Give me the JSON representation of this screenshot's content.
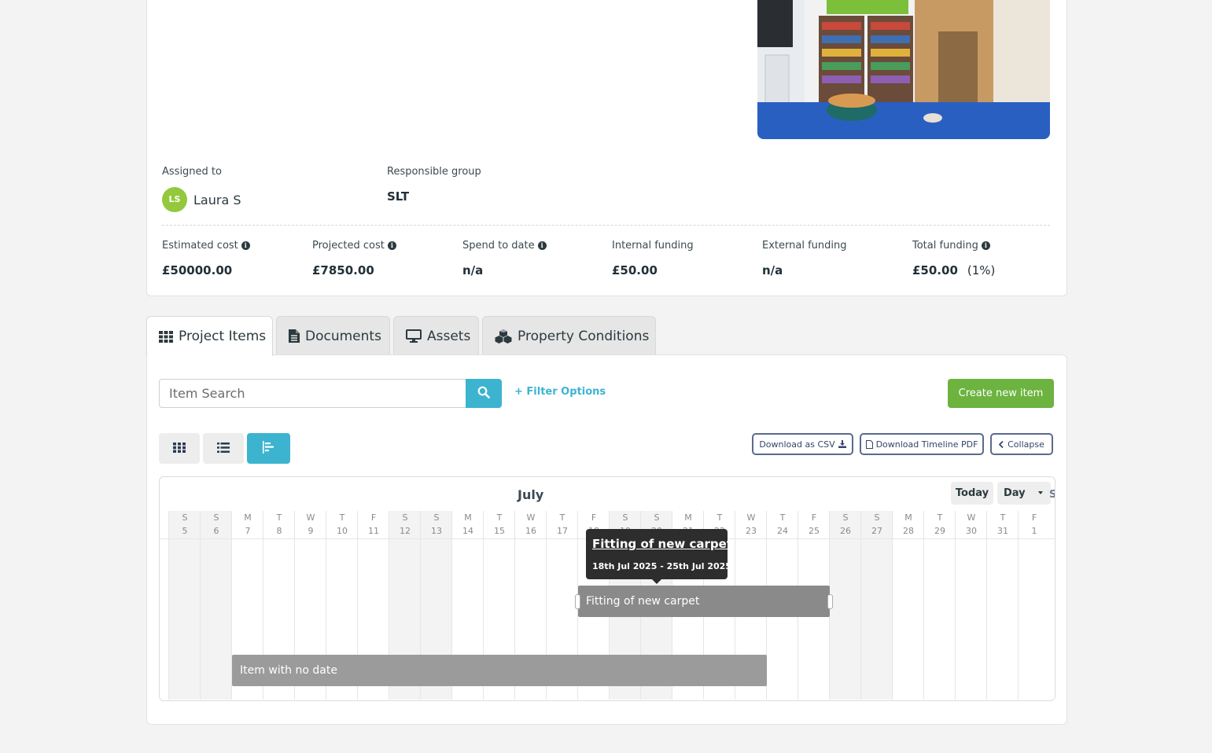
{
  "project": {
    "assigned": {
      "label": "Assigned to",
      "initials": "LS",
      "name": "Laura S"
    },
    "group": {
      "label": "Responsible group",
      "value": "SLT"
    },
    "costs": [
      {
        "label": "Estimated cost",
        "value": "£50000.00",
        "info": true
      },
      {
        "label": "Projected cost",
        "value": "£7850.00",
        "info": true
      },
      {
        "label": "Spend to date",
        "value": "n/a",
        "info": true
      },
      {
        "label": "Internal funding",
        "value": "£50.00",
        "info": false
      },
      {
        "label": "External funding",
        "value": "n/a",
        "info": false
      },
      {
        "label": "Total funding",
        "value": "£50.00",
        "extra": "(1%)",
        "info": true
      }
    ]
  },
  "tabs": [
    {
      "label": "Project Items",
      "icon": "grid-icon",
      "active": true
    },
    {
      "label": "Documents",
      "icon": "document-icon"
    },
    {
      "label": "Assets",
      "icon": "monitor-icon"
    },
    {
      "label": "Property Conditions",
      "icon": "cubes-icon"
    }
  ],
  "toolbar": {
    "search_placeholder": "Item Search",
    "filter_label": "+ Filter Options",
    "create_label": "Create new item",
    "csv_label": "Download as CSV",
    "pdf_label": "Download Timeline PDF",
    "collapse_label": "Collapse"
  },
  "timeline": {
    "month": "July",
    "today_label": "Today",
    "view_select": "Day",
    "edge_label": "S",
    "days": [
      {
        "d": "S",
        "n": "5"
      },
      {
        "d": "S",
        "n": "6"
      },
      {
        "d": "M",
        "n": "7"
      },
      {
        "d": "T",
        "n": "8"
      },
      {
        "d": "W",
        "n": "9"
      },
      {
        "d": "T",
        "n": "10"
      },
      {
        "d": "F",
        "n": "11"
      },
      {
        "d": "S",
        "n": "12"
      },
      {
        "d": "S",
        "n": "13"
      },
      {
        "d": "M",
        "n": "14"
      },
      {
        "d": "T",
        "n": "15"
      },
      {
        "d": "W",
        "n": "16"
      },
      {
        "d": "T",
        "n": "17"
      },
      {
        "d": "F",
        "n": "18"
      },
      {
        "d": "S",
        "n": "19"
      },
      {
        "d": "S",
        "n": "20"
      },
      {
        "d": "M",
        "n": "21"
      },
      {
        "d": "T",
        "n": "22"
      },
      {
        "d": "W",
        "n": "23"
      },
      {
        "d": "T",
        "n": "24"
      },
      {
        "d": "F",
        "n": "25"
      },
      {
        "d": "S",
        "n": "26"
      },
      {
        "d": "S",
        "n": "27"
      },
      {
        "d": "M",
        "n": "28"
      },
      {
        "d": "T",
        "n": "29"
      },
      {
        "d": "W",
        "n": "30"
      },
      {
        "d": "T",
        "n": "31"
      },
      {
        "d": "F",
        "n": "1"
      }
    ],
    "items": [
      {
        "label": "Fitting of new carpet",
        "start_day": "18",
        "end_day": "25"
      },
      {
        "label": "Item with no date",
        "start_day": "7",
        "end_day": "23"
      }
    ],
    "tooltip": {
      "title": "Fitting of new carpet",
      "dates": "18th Jul 2025 - 25th Jul 2025"
    }
  },
  "colors": {
    "accent": "#3cb4cf",
    "create": "#6cb33f",
    "avatar": "#94c83d",
    "bar": "#8a8a8a"
  }
}
